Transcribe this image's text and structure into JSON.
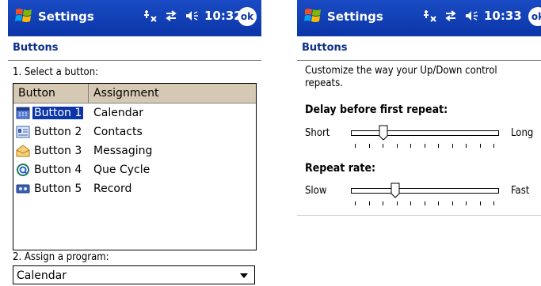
{
  "left": {
    "title": "Settings",
    "time": "10:32",
    "ok_label": "ok",
    "heading": "Buttons",
    "select_label": "1. Select a button:",
    "columns": [
      "Button",
      "Assignment"
    ],
    "rows": [
      {
        "button": "Button 1",
        "assignment": "Calendar",
        "icon": "calendar-icon",
        "selected": true
      },
      {
        "button": "Button 2",
        "assignment": "Contacts",
        "icon": "contacts-icon",
        "selected": false
      },
      {
        "button": "Button 3",
        "assignment": "Messaging",
        "icon": "messaging-icon",
        "selected": false
      },
      {
        "button": "Button 4",
        "assignment": "Que Cycle",
        "icon": "que-cycle-icon",
        "selected": false
      },
      {
        "button": "Button 5",
        "assignment": "Record",
        "icon": "record-icon",
        "selected": false
      }
    ],
    "assign_label": "2. Assign a program:",
    "assign_value": "Calendar"
  },
  "right": {
    "title": "Settings",
    "time": "10:33",
    "ok_label": "ok",
    "heading": "Buttons",
    "description": "Customize the way your Up/Down control repeats.",
    "delay_label": "Delay before first repeat:",
    "delay_min": "Short",
    "delay_max": "Long",
    "delay_level": 0.22,
    "rate_label": "Repeat rate:",
    "rate_min": "Slow",
    "rate_max": "Fast",
    "rate_level": 0.3
  },
  "colors": {
    "titlebar": "#0b35a8",
    "heading_text": "#0b2e8a",
    "selection": "#0b35a8",
    "list_header": "#d6c9b4"
  }
}
